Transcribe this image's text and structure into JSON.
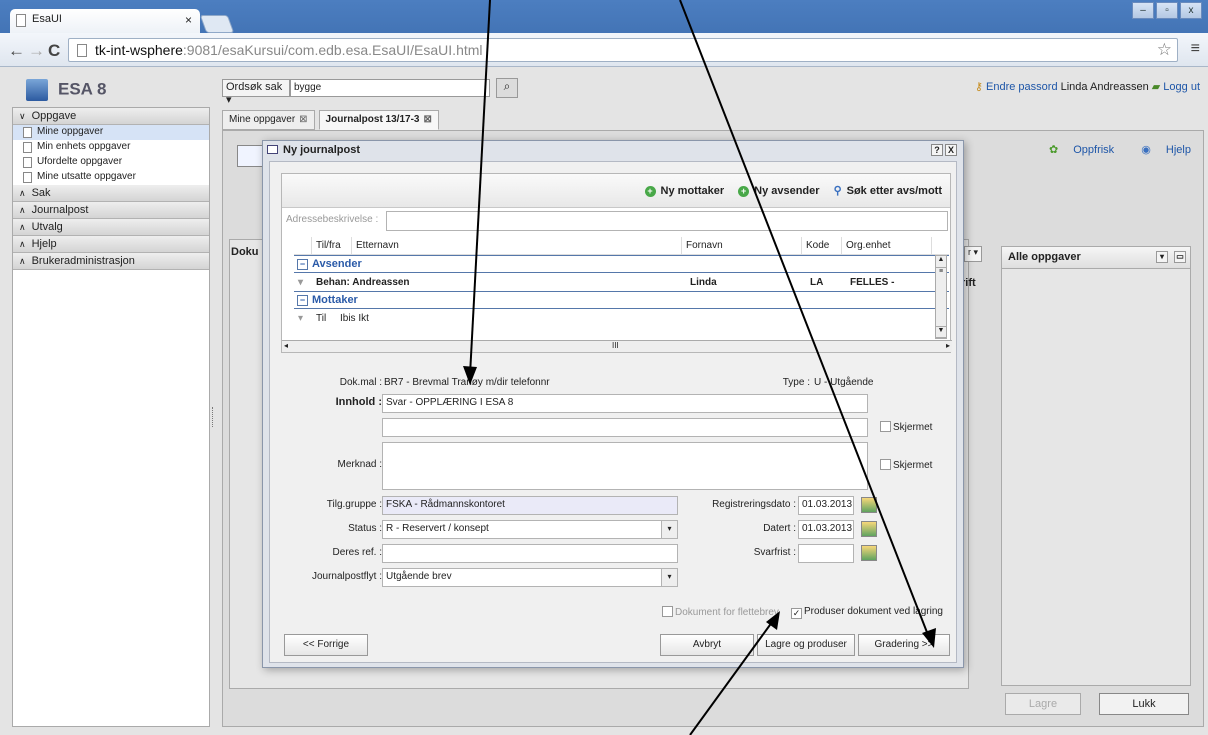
{
  "browser": {
    "tab_title": "EsaUI",
    "tab_close": "×",
    "url_host": "tk-int-wsphere",
    "url_rest": ":9081/esaKursui/com.edb.esa.EsaUI/EsaUI.html",
    "back": "←",
    "forward": "→",
    "reload": "C",
    "star": "☆",
    "menu": "≡",
    "win_min": "–",
    "win_max": "▫",
    "win_close": "x"
  },
  "app": {
    "brand": "ESA 8",
    "search_scope": "Ordsøk sak ▾",
    "search_value": "bygge",
    "change_password": "Endre passord",
    "user_name": "Linda Andreassen",
    "logout": "Logg ut"
  },
  "sidebar": {
    "oppgave": "Oppgave",
    "items": [
      "Mine oppgaver",
      "Min enhets oppgaver",
      "Ufordelte oppgaver",
      "Mine utsatte oppgaver"
    ],
    "sections": [
      "Sak",
      "Journalpost",
      "Utvalg",
      "Hjelp",
      "Brukeradministrasjon"
    ]
  },
  "main": {
    "tabs": [
      "Mine oppgaver",
      "Journalpost 13/17-3"
    ],
    "tab_close": "⊠",
    "refresh": "Oppfrisk",
    "help": "Hjelp",
    "doku": "Doku",
    "rift": "rift",
    "alle_oppgaver": "Alle oppgaver",
    "lagre": "Lagre",
    "lukk": "Lukk",
    "dd": "r ▾"
  },
  "dialog": {
    "title": "Ny journalpost",
    "help_btn": "?",
    "close_btn": "X",
    "actions": [
      "Ny mottaker",
      "Ny avsender",
      "Søk etter avs/mott"
    ],
    "adr_label": "Adressebeskrivelse :",
    "columns": [
      "Til/fra",
      "Etternavn",
      "Fornavn",
      "Kode",
      "Org.enhet"
    ],
    "groups": {
      "avsender": "Avsender",
      "mottaker": "Mottaker"
    },
    "rows": [
      {
        "tilfra": "Behan: Andreassen",
        "fornavn": "Linda",
        "kode": "LA",
        "org": "FELLES -"
      },
      {
        "tilfra": "Til",
        "etternavn": "Ibis Ikt"
      }
    ],
    "scroll_mid": "III",
    "form": {
      "dokmal_label": "Dok.mal :",
      "dokmal_value": "BR7 - Brevmal Tranøy m/dir telefonnr",
      "type_label": "Type :",
      "type_value": "U - Utgående",
      "innhold_label": "Innhold :",
      "innhold_value": "Svar - OPPLÆRING I ESA 8",
      "skjermet": "Skjermet",
      "merknad_label": "Merknad :",
      "tilg_label": "Tilg.gruppe :",
      "tilg_value": "FSKA - Rådmannskontoret",
      "regdato_label": "Registreringsdato :",
      "regdato_value": "01.03.2013",
      "status_label": "Status :",
      "status_value": "R - Reservert / konsept",
      "datert_label": "Datert :",
      "datert_value": "01.03.2013",
      "deres_label": "Deres ref. :",
      "svarfrist_label": "Svarfrist :",
      "jpflyt_label": "Journalpostflyt :",
      "jpflyt_value": "Utgående brev",
      "dok_flettebrev": "Dokument for flettebrev",
      "produser": "Produser dokument ved lagring"
    },
    "buttons": {
      "forrige": "<< Forrige",
      "avbryt": "Avbryt",
      "lagre_produser": "Lagre og produser",
      "gradering": "Gradering >>"
    }
  }
}
